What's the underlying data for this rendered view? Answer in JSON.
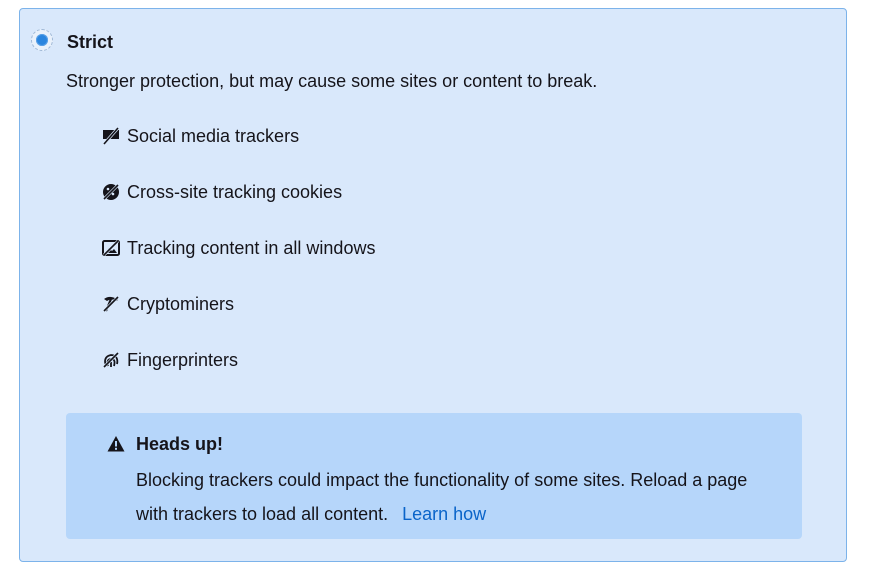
{
  "option": {
    "title": "Strict",
    "description": "Stronger protection, but may cause some sites or content to break.",
    "selected": true
  },
  "features": [
    {
      "icon": "social-tracker-icon",
      "label": "Social media trackers"
    },
    {
      "icon": "cookie-icon",
      "label": "Cross-site tracking cookies"
    },
    {
      "icon": "tracking-content-icon",
      "label": "Tracking content in all windows"
    },
    {
      "icon": "cryptominer-icon",
      "label": "Cryptominers"
    },
    {
      "icon": "fingerprinter-icon",
      "label": "Fingerprinters"
    }
  ],
  "notice": {
    "icon": "warning-icon",
    "title": "Heads up!",
    "body": "Blocking trackers could impact the functionality of some sites. Reload a page with trackers to load all content.",
    "link_label": "Learn how"
  },
  "colors": {
    "panel_bg": "#d9e8fb",
    "panel_border": "#7cb3ea",
    "notice_bg": "#b6d6fa",
    "link": "#0a64c9",
    "radio": "#2a85df"
  }
}
